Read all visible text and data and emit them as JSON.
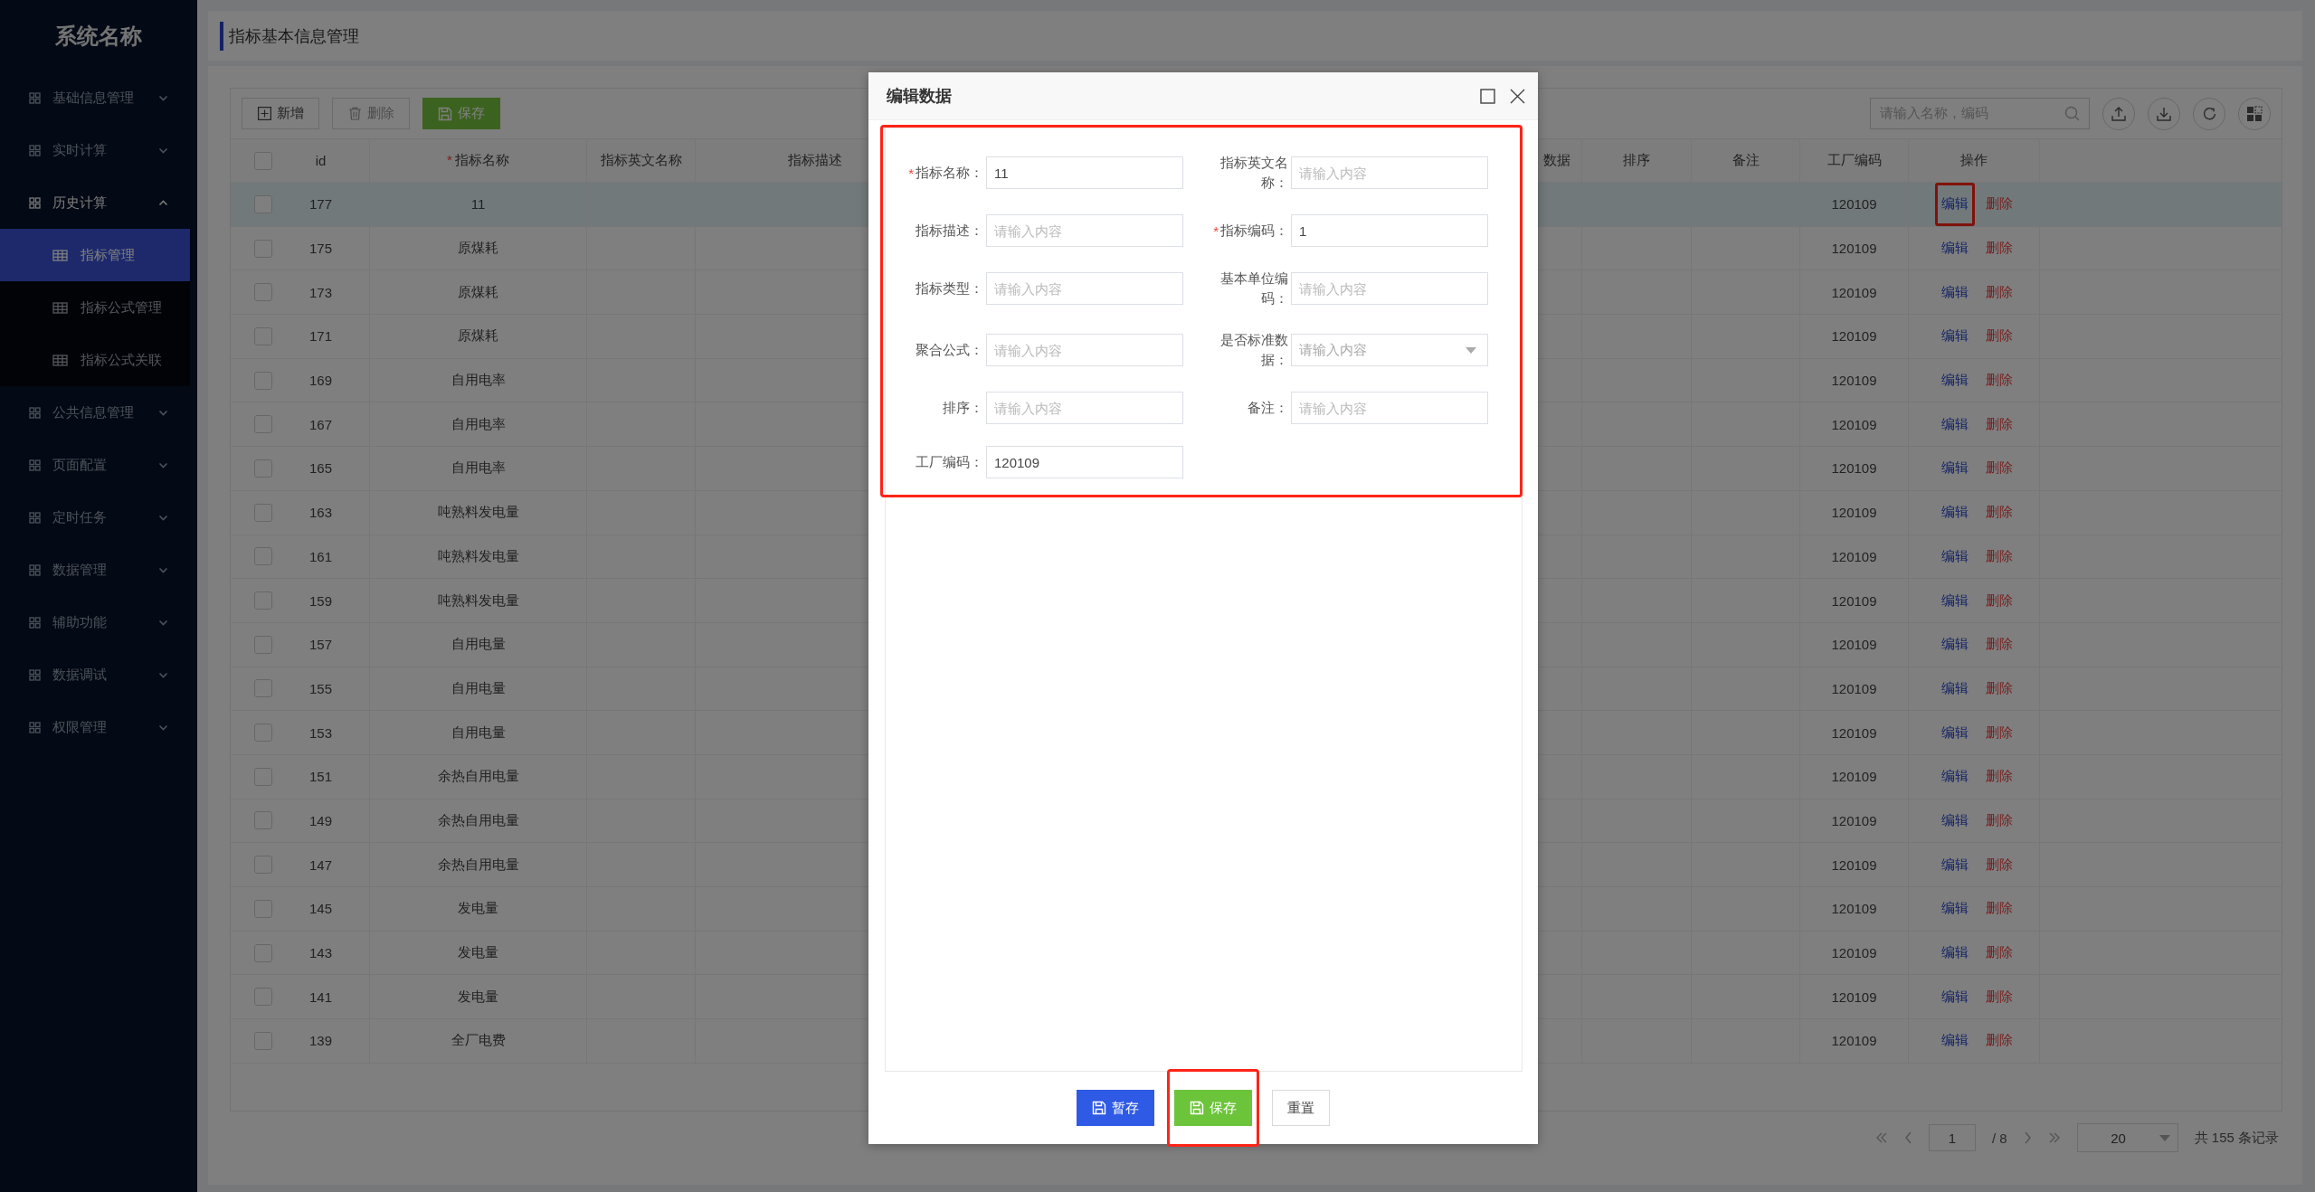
{
  "sidebar": {
    "title": "系统名称",
    "items": [
      {
        "label": "基础信息管理",
        "expanded": false
      },
      {
        "label": "实时计算",
        "expanded": false
      },
      {
        "label": "历史计算",
        "expanded": true,
        "children": [
          {
            "label": "指标管理",
            "selected": true
          },
          {
            "label": "指标公式管理",
            "selected": false
          },
          {
            "label": "指标公式关联",
            "selected": false
          }
        ]
      },
      {
        "label": "公共信息管理",
        "expanded": false
      },
      {
        "label": "页面配置",
        "expanded": false
      },
      {
        "label": "定时任务",
        "expanded": false
      },
      {
        "label": "数据管理",
        "expanded": false
      },
      {
        "label": "辅助功能",
        "expanded": false
      },
      {
        "label": "数据调试",
        "expanded": false
      },
      {
        "label": "权限管理",
        "expanded": false
      }
    ]
  },
  "page_title": "指标基本信息管理",
  "toolbar": {
    "buttons": [
      {
        "label": "新增",
        "kind": "add"
      },
      {
        "label": "删除",
        "kind": "delete"
      },
      {
        "label": "保存",
        "kind": "save"
      }
    ],
    "search": {
      "placeholder": "请输入名称，编码"
    }
  },
  "table": {
    "all_checked": false,
    "columns": [
      {
        "label": "id",
        "kind": "id"
      },
      {
        "label": "指标名称",
        "kind": "name",
        "mark": "*"
      },
      {
        "label": "指标英文名称",
        "kind": "plain"
      },
      {
        "label": "指标描述",
        "kind": "plain"
      },
      {
        "label": "数据",
        "kind": "plain"
      },
      {
        "label": "排序",
        "kind": "plain"
      },
      {
        "label": "备注",
        "kind": "plain"
      },
      {
        "label": "工厂编码",
        "kind": "code"
      },
      {
        "label": "操作",
        "kind": "actions"
      }
    ],
    "rows": [
      {
        "id": "177",
        "name": "11",
        "factory_code": "120109",
        "edit": "编辑",
        "delete": "删除",
        "checked": false,
        "selected": true,
        "edit_marked": true
      },
      {
        "id": "175",
        "name": "原煤耗",
        "factory_code": "120109",
        "edit": "编辑",
        "delete": "删除",
        "checked": false,
        "selected": false,
        "edit_marked": false
      },
      {
        "id": "173",
        "name": "原煤耗",
        "factory_code": "120109",
        "edit": "编辑",
        "delete": "删除",
        "checked": false,
        "selected": false,
        "edit_marked": false
      },
      {
        "id": "171",
        "name": "原煤耗",
        "factory_code": "120109",
        "edit": "编辑",
        "delete": "删除",
        "checked": false,
        "selected": false,
        "edit_marked": false
      },
      {
        "id": "169",
        "name": "自用电率",
        "factory_code": "120109",
        "edit": "编辑",
        "delete": "删除",
        "checked": false,
        "selected": false,
        "edit_marked": false
      },
      {
        "id": "167",
        "name": "自用电率",
        "factory_code": "120109",
        "edit": "编辑",
        "delete": "删除",
        "checked": false,
        "selected": false,
        "edit_marked": false
      },
      {
        "id": "165",
        "name": "自用电率",
        "factory_code": "120109",
        "edit": "编辑",
        "delete": "删除",
        "checked": false,
        "selected": false,
        "edit_marked": false
      },
      {
        "id": "163",
        "name": "吨熟料发电量",
        "factory_code": "120109",
        "edit": "编辑",
        "delete": "删除",
        "checked": false,
        "selected": false,
        "edit_marked": false
      },
      {
        "id": "161",
        "name": "吨熟料发电量",
        "factory_code": "120109",
        "edit": "编辑",
        "delete": "删除",
        "checked": false,
        "selected": false,
        "edit_marked": false
      },
      {
        "id": "159",
        "name": "吨熟料发电量",
        "factory_code": "120109",
        "edit": "编辑",
        "delete": "删除",
        "checked": false,
        "selected": false,
        "edit_marked": false
      },
      {
        "id": "157",
        "name": "自用电量",
        "factory_code": "120109",
        "edit": "编辑",
        "delete": "删除",
        "checked": false,
        "selected": false,
        "edit_marked": false
      },
      {
        "id": "155",
        "name": "自用电量",
        "factory_code": "120109",
        "edit": "编辑",
        "delete": "删除",
        "checked": false,
        "selected": false,
        "edit_marked": false
      },
      {
        "id": "153",
        "name": "自用电量",
        "factory_code": "120109",
        "edit": "编辑",
        "delete": "删除",
        "checked": false,
        "selected": false,
        "edit_marked": false
      },
      {
        "id": "151",
        "name": "余热自用电量",
        "factory_code": "120109",
        "edit": "编辑",
        "delete": "删除",
        "checked": false,
        "selected": false,
        "edit_marked": false
      },
      {
        "id": "149",
        "name": "余热自用电量",
        "factory_code": "120109",
        "edit": "编辑",
        "delete": "删除",
        "checked": false,
        "selected": false,
        "edit_marked": false
      },
      {
        "id": "147",
        "name": "余热自用电量",
        "factory_code": "120109",
        "edit": "编辑",
        "delete": "删除",
        "checked": false,
        "selected": false,
        "edit_marked": false
      },
      {
        "id": "145",
        "name": "发电量",
        "factory_code": "120109",
        "edit": "编辑",
        "delete": "删除",
        "checked": false,
        "selected": false,
        "edit_marked": false
      },
      {
        "id": "143",
        "name": "发电量",
        "factory_code": "120109",
        "edit": "编辑",
        "delete": "删除",
        "checked": false,
        "selected": false,
        "edit_marked": false
      },
      {
        "id": "141",
        "name": "发电量",
        "factory_code": "120109",
        "edit": "编辑",
        "delete": "删除",
        "checked": false,
        "selected": false,
        "edit_marked": false
      },
      {
        "id": "139",
        "name": "全厂电费",
        "factory_code": "120109",
        "edit": "编辑",
        "delete": "删除",
        "checked": false,
        "selected": false,
        "edit_marked": false
      }
    ]
  },
  "pagination": {
    "page": "1",
    "total_pages": "/ 8",
    "page_size": "20",
    "summary": "共 155 条记录"
  },
  "dialog": {
    "title": "编辑数据",
    "form_marked": true,
    "fields": [
      {
        "label": "指标名称：",
        "mark": "*",
        "kind": "input",
        "value": "11"
      },
      {
        "label": "指标英文名称：",
        "kind": "input",
        "placeholder": "请输入内容"
      },
      {
        "label": "指标描述：",
        "kind": "input",
        "placeholder": "请输入内容"
      },
      {
        "label": "指标编码：",
        "mark": "*",
        "kind": "input",
        "value": "1"
      },
      {
        "label": "指标类型：",
        "kind": "input",
        "placeholder": "请输入内容"
      },
      {
        "label": "基本单位编码：",
        "kind": "input",
        "placeholder": "请输入内容"
      },
      {
        "label": "聚合公式：",
        "kind": "input",
        "placeholder": "请输入内容"
      },
      {
        "label": "是否标准数据：",
        "kind": "select",
        "placeholder": "请输入内容"
      },
      {
        "label": "排序：",
        "kind": "input",
        "placeholder": "请输入内容"
      },
      {
        "label": "备注：",
        "kind": "input",
        "placeholder": "请输入内容"
      },
      {
        "label": "工厂编码：",
        "kind": "input",
        "value": "120109"
      }
    ],
    "buttons": [
      {
        "label": "暂存",
        "kind": "draft",
        "marked": false
      },
      {
        "label": "保存",
        "kind": "save",
        "marked": true
      },
      {
        "label": "重置",
        "kind": "reset",
        "marked": false
      }
    ]
  }
}
